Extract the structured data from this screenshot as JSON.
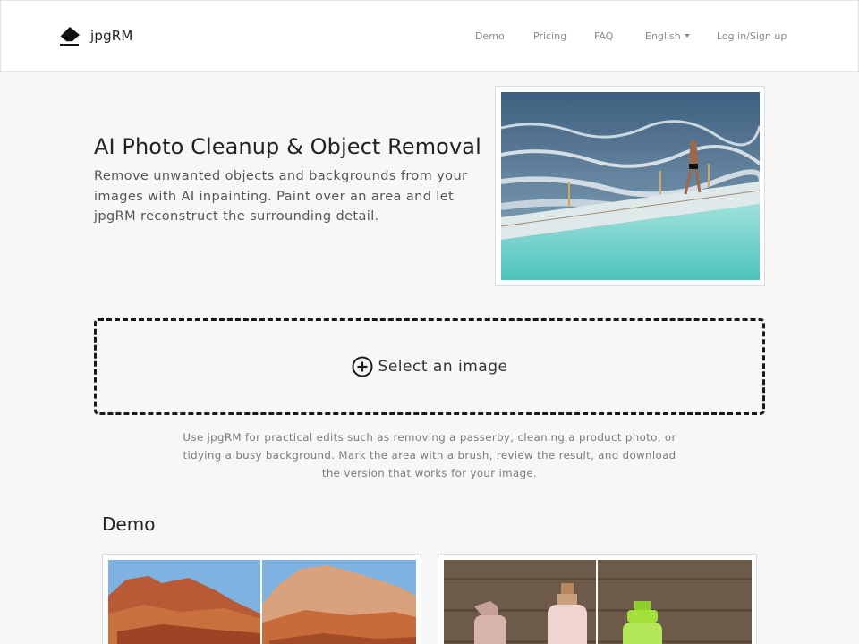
{
  "brand": {
    "name": "jpgRM",
    "icon": "eraser-icon"
  },
  "nav": {
    "demo": "Demo",
    "pricing": "Pricing",
    "faq": "FAQ",
    "language": "English",
    "login": "Log in/Sign up"
  },
  "hero": {
    "title": "AI Photo Cleanup & Object Removal",
    "description": "Remove unwanted objects and backgrounds from your images with AI inpainting. Paint over an area and let jpgRM reconstruct the surrounding detail."
  },
  "upload": {
    "label": "Select an image",
    "icon": "plus-circle-icon"
  },
  "helper_text": "Use jpgRM for practical edits such as removing a passerby, cleaning a product photo, or tidying a busy background. Mark the area with a brush, review the result, and download the version that works for your image.",
  "demo": {
    "title": "Demo"
  }
}
